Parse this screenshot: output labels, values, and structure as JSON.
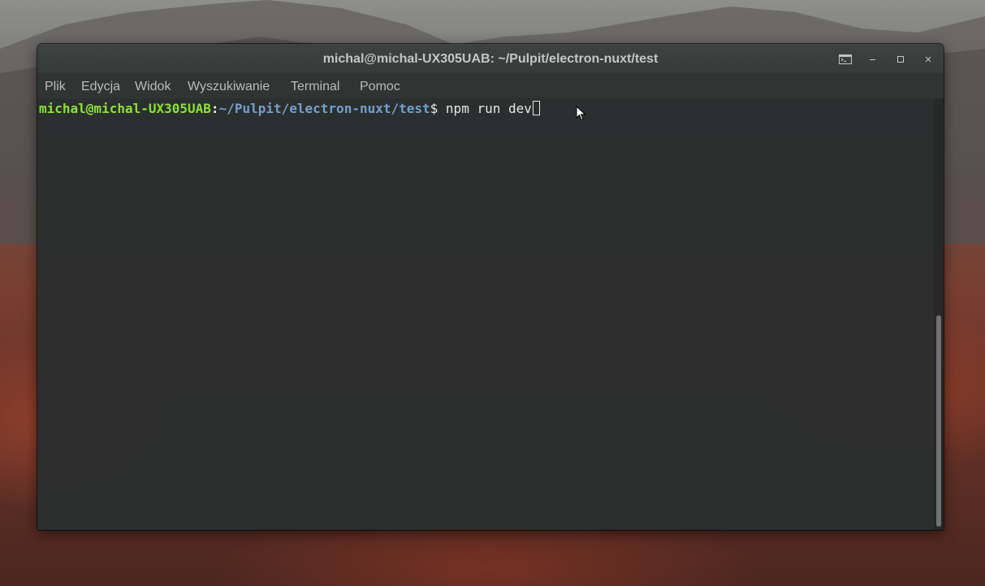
{
  "window": {
    "title": "michal@michal-UX305UAB: ~/Pulpit/electron-nuxt/test",
    "controls": {
      "terminal_icon": "terminal-icon",
      "minimize_icon": "minimize-icon",
      "maximize_icon": "maximize-icon",
      "close_icon": "close-icon"
    }
  },
  "menubar": {
    "items": [
      {
        "label": "Plik"
      },
      {
        "label": "Edycja"
      },
      {
        "label": "Widok"
      },
      {
        "label": "Wyszukiwanie"
      },
      {
        "label": "Terminal"
      },
      {
        "label": "Pomoc"
      }
    ]
  },
  "terminal": {
    "prompt_user": "michal@michal-UX305UAB",
    "prompt_colon": ":",
    "prompt_path": "~/Pulpit/electron-nuxt/test",
    "prompt_dollar": "$ ",
    "command": "npm run dev"
  },
  "colors": {
    "prompt_user": "#8ae234",
    "prompt_path": "#729fcf",
    "text": "#e6e6e6",
    "titlebar": "#3a3e3d"
  }
}
